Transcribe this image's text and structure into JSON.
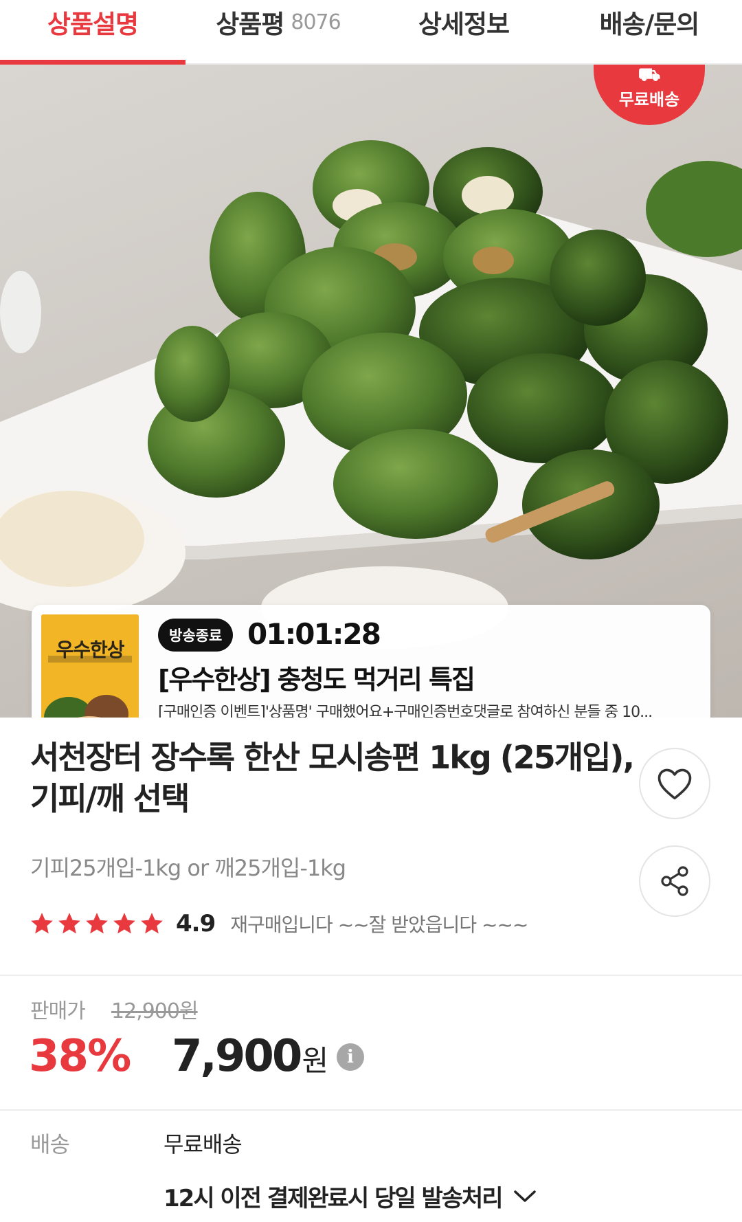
{
  "tabs": [
    {
      "label": "상품설명",
      "count": "",
      "active": true
    },
    {
      "label": "상품평",
      "count": "8076",
      "active": false
    },
    {
      "label": "상세정보",
      "count": "",
      "active": false
    },
    {
      "label": "배송/문의",
      "count": "",
      "active": false
    }
  ],
  "hero": {
    "free_shipping_badge": "무료배송"
  },
  "live": {
    "status": "방송종료",
    "timer": "01:01:28",
    "title": "[우수한상] 충청도 먹거리 특집",
    "description": "[구매인증 이벤트]'상품명' 구매했어요+구매인증번호댓글로 참여하신 분들 중 10...",
    "thumbnail_title": "우수한상",
    "carousel": {
      "count": 3,
      "active_index": 0
    }
  },
  "product": {
    "title": "서천장터 장수록 한산 모시송편 1kg (25개입), 기피/깨 선택",
    "options": "기피25개입-1kg or 깨25개입-1kg",
    "rating": "4.9",
    "stars": 5,
    "review_snippet": "재구매입니다 ~~잘 받았읍니다 ~~~"
  },
  "price": {
    "label": "판매가",
    "original": "12,900원",
    "discount": "38%",
    "amount": "7,900",
    "unit": "원"
  },
  "shipping": {
    "label": "배송",
    "value": "무료배송",
    "notice": "12시 이전 결제완료시 당일 발송처리"
  },
  "colors": {
    "accent": "#e8393f",
    "text": "#222222",
    "muted": "#999999"
  },
  "icons": [
    "heart-icon",
    "share-icon",
    "truck-icon",
    "info-icon",
    "chevron-down-icon",
    "star-icon"
  ]
}
